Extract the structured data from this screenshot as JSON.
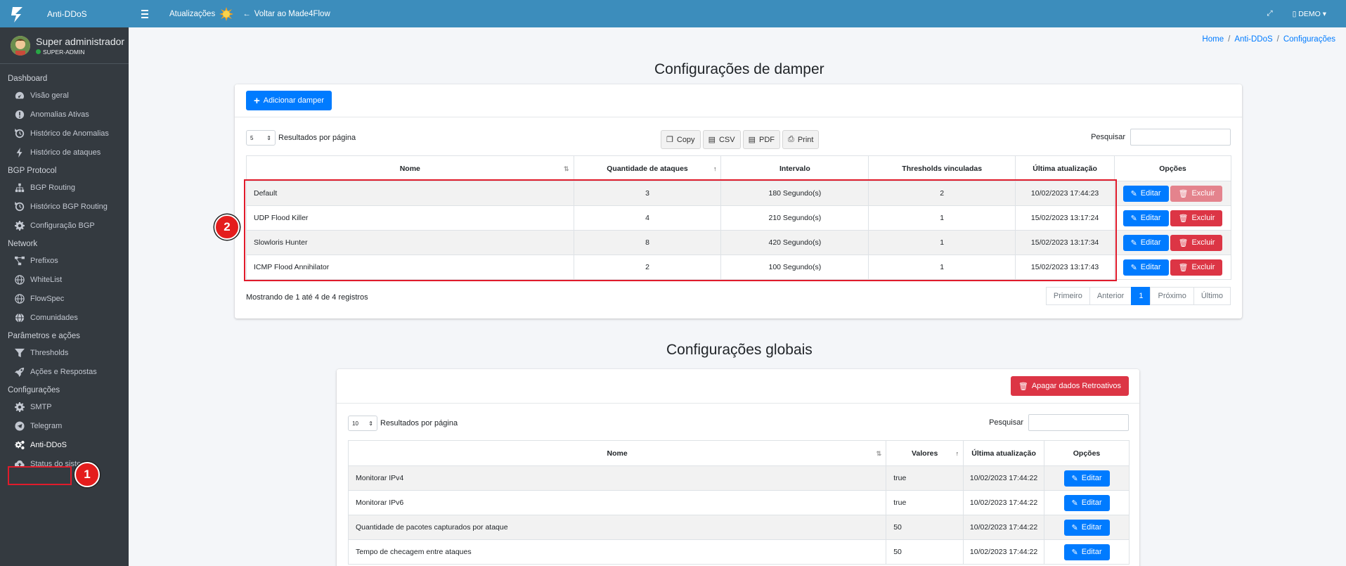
{
  "brand": {
    "name": "Anti-DDoS"
  },
  "topbar": {
    "updates_label": "Atualizações",
    "back_label": "Voltar ao Made4Flow",
    "tenant": "DEMO"
  },
  "user": {
    "name": "Super administrador",
    "role": "SUPER-ADMIN"
  },
  "sidebar": {
    "dashboard": {
      "header": "Dashboard",
      "items": [
        "Visão geral",
        "Anomalias Ativas",
        "Histórico de Anomalias",
        "Histórico de ataques"
      ]
    },
    "bgp": {
      "header": "BGP Protocol",
      "items": [
        "BGP Routing",
        "Histórico BGP Routing",
        "Configuração BGP"
      ]
    },
    "network": {
      "header": "Network",
      "items": [
        "Prefixos",
        "WhiteList",
        "FlowSpec",
        "Comunidades"
      ]
    },
    "params": {
      "header": "Parâmetros e ações",
      "items": [
        "Thresholds",
        "Ações e Respostas"
      ]
    },
    "config": {
      "header": "Configurações",
      "items": [
        "SMTP",
        "Telegram",
        "Anti-DDoS",
        "Status do sistema"
      ]
    }
  },
  "breadcrumb": [
    "Home",
    "Anti-DDoS",
    "Configurações"
  ],
  "damper": {
    "title": "Configurações de damper",
    "add_label": "Adicionar damper",
    "page_len": "5",
    "per_page_label": "Resultados por página",
    "export": [
      "Copy",
      "CSV",
      "PDF",
      "Print"
    ],
    "search_label": "Pesquisar",
    "columns": [
      "Nome",
      "Quantidade de ataques",
      "Intervalo",
      "Thresholds vinculadas",
      "Última atualização",
      "Opções"
    ],
    "rows": [
      [
        "Default",
        "3",
        "180 Segundo(s)",
        "2",
        "10/02/2023 17:44:23"
      ],
      [
        "UDP Flood Killer",
        "4",
        "210 Segundo(s)",
        "1",
        "15/02/2023 13:17:24"
      ],
      [
        "Slowloris Hunter",
        "8",
        "420 Segundo(s)",
        "1",
        "15/02/2023 13:17:34"
      ],
      [
        "ICMP Flood Annihilator",
        "2",
        "100 Segundo(s)",
        "1",
        "15/02/2023 13:17:43"
      ]
    ],
    "edit_label": "Editar",
    "delete_label": "Excluir",
    "info": "Mostrando de 1 até 4 de 4 registros",
    "pager": [
      "Primeiro",
      "Anterior",
      "1",
      "Próximo",
      "Último"
    ]
  },
  "global": {
    "title": "Configurações globais",
    "purge_label": "Apagar dados Retroativos",
    "page_len": "10",
    "per_page_label": "Resultados por página",
    "search_label": "Pesquisar",
    "columns": [
      "Nome",
      "Valores",
      "Última atualização",
      "Opções"
    ],
    "rows": [
      [
        "Monitorar IPv4",
        "true",
        "10/02/2023 17:44:22"
      ],
      [
        "Monitorar IPv6",
        "true",
        "10/02/2023 17:44:22"
      ],
      [
        "Quantidade de pacotes capturados por ataque",
        "50",
        "10/02/2023 17:44:22"
      ],
      [
        "Tempo de checagem entre ataques",
        "50",
        "10/02/2023 17:44:22"
      ]
    ],
    "edit_label": "Editar"
  },
  "annotations": [
    "1",
    "2"
  ]
}
